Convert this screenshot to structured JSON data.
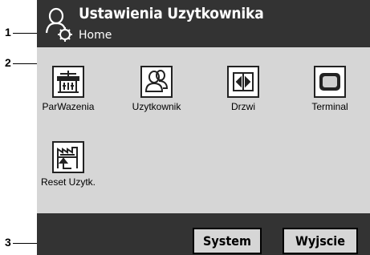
{
  "callouts": {
    "one": "1",
    "two": "2",
    "three": "3"
  },
  "header": {
    "title": "Ustawienia Uzytkownika",
    "subtitle": "Home"
  },
  "tiles": [
    {
      "label": "ParWazenia",
      "icon": "balance-icon"
    },
    {
      "label": "Uzytkownik",
      "icon": "user-icon"
    },
    {
      "label": "Drzwi",
      "icon": "door-icon"
    },
    {
      "label": "Terminal",
      "icon": "terminal-icon"
    },
    {
      "label": "Reset Uzytk.",
      "icon": "reset-factory-icon"
    }
  ],
  "footer": {
    "system_label": "System",
    "exit_label": "Wyjscie"
  },
  "colors": {
    "header_bg": "#333333",
    "screen_bg": "#d6d6d6",
    "footer_bg": "#333333"
  }
}
